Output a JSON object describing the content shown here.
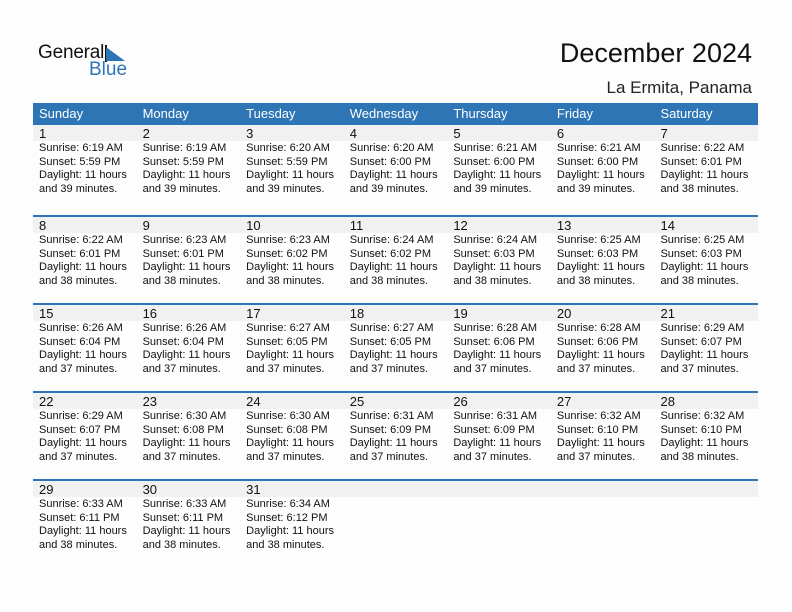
{
  "logo": {
    "general": "General",
    "blue": "Blue",
    "accent": "#2E75B6"
  },
  "header": {
    "title": "December 2024",
    "location": "La Ermita, Panama"
  },
  "weekdays": [
    "Sunday",
    "Monday",
    "Tuesday",
    "Wednesday",
    "Thursday",
    "Friday",
    "Saturday"
  ],
  "weeks": [
    [
      {
        "day": "1",
        "sunrise": "Sunrise: 6:19 AM",
        "sunset": "Sunset: 5:59 PM",
        "daylight": "Daylight: 11 hours",
        "minutes": "and 39 minutes."
      },
      {
        "day": "2",
        "sunrise": "Sunrise: 6:19 AM",
        "sunset": "Sunset: 5:59 PM",
        "daylight": "Daylight: 11 hours",
        "minutes": "and 39 minutes."
      },
      {
        "day": "3",
        "sunrise": "Sunrise: 6:20 AM",
        "sunset": "Sunset: 5:59 PM",
        "daylight": "Daylight: 11 hours",
        "minutes": "and 39 minutes."
      },
      {
        "day": "4",
        "sunrise": "Sunrise: 6:20 AM",
        "sunset": "Sunset: 6:00 PM",
        "daylight": "Daylight: 11 hours",
        "minutes": "and 39 minutes."
      },
      {
        "day": "5",
        "sunrise": "Sunrise: 6:21 AM",
        "sunset": "Sunset: 6:00 PM",
        "daylight": "Daylight: 11 hours",
        "minutes": "and 39 minutes."
      },
      {
        "day": "6",
        "sunrise": "Sunrise: 6:21 AM",
        "sunset": "Sunset: 6:00 PM",
        "daylight": "Daylight: 11 hours",
        "minutes": "and 39 minutes."
      },
      {
        "day": "7",
        "sunrise": "Sunrise: 6:22 AM",
        "sunset": "Sunset: 6:01 PM",
        "daylight": "Daylight: 11 hours",
        "minutes": "and 38 minutes."
      }
    ],
    [
      {
        "day": "8",
        "sunrise": "Sunrise: 6:22 AM",
        "sunset": "Sunset: 6:01 PM",
        "daylight": "Daylight: 11 hours",
        "minutes": "and 38 minutes."
      },
      {
        "day": "9",
        "sunrise": "Sunrise: 6:23 AM",
        "sunset": "Sunset: 6:01 PM",
        "daylight": "Daylight: 11 hours",
        "minutes": "and 38 minutes."
      },
      {
        "day": "10",
        "sunrise": "Sunrise: 6:23 AM",
        "sunset": "Sunset: 6:02 PM",
        "daylight": "Daylight: 11 hours",
        "minutes": "and 38 minutes."
      },
      {
        "day": "11",
        "sunrise": "Sunrise: 6:24 AM",
        "sunset": "Sunset: 6:02 PM",
        "daylight": "Daylight: 11 hours",
        "minutes": "and 38 minutes."
      },
      {
        "day": "12",
        "sunrise": "Sunrise: 6:24 AM",
        "sunset": "Sunset: 6:03 PM",
        "daylight": "Daylight: 11 hours",
        "minutes": "and 38 minutes."
      },
      {
        "day": "13",
        "sunrise": "Sunrise: 6:25 AM",
        "sunset": "Sunset: 6:03 PM",
        "daylight": "Daylight: 11 hours",
        "minutes": "and 38 minutes."
      },
      {
        "day": "14",
        "sunrise": "Sunrise: 6:25 AM",
        "sunset": "Sunset: 6:03 PM",
        "daylight": "Daylight: 11 hours",
        "minutes": "and 38 minutes."
      }
    ],
    [
      {
        "day": "15",
        "sunrise": "Sunrise: 6:26 AM",
        "sunset": "Sunset: 6:04 PM",
        "daylight": "Daylight: 11 hours",
        "minutes": "and 37 minutes."
      },
      {
        "day": "16",
        "sunrise": "Sunrise: 6:26 AM",
        "sunset": "Sunset: 6:04 PM",
        "daylight": "Daylight: 11 hours",
        "minutes": "and 37 minutes."
      },
      {
        "day": "17",
        "sunrise": "Sunrise: 6:27 AM",
        "sunset": "Sunset: 6:05 PM",
        "daylight": "Daylight: 11 hours",
        "minutes": "and 37 minutes."
      },
      {
        "day": "18",
        "sunrise": "Sunrise: 6:27 AM",
        "sunset": "Sunset: 6:05 PM",
        "daylight": "Daylight: 11 hours",
        "minutes": "and 37 minutes."
      },
      {
        "day": "19",
        "sunrise": "Sunrise: 6:28 AM",
        "sunset": "Sunset: 6:06 PM",
        "daylight": "Daylight: 11 hours",
        "minutes": "and 37 minutes."
      },
      {
        "day": "20",
        "sunrise": "Sunrise: 6:28 AM",
        "sunset": "Sunset: 6:06 PM",
        "daylight": "Daylight: 11 hours",
        "minutes": "and 37 minutes."
      },
      {
        "day": "21",
        "sunrise": "Sunrise: 6:29 AM",
        "sunset": "Sunset: 6:07 PM",
        "daylight": "Daylight: 11 hours",
        "minutes": "and 37 minutes."
      }
    ],
    [
      {
        "day": "22",
        "sunrise": "Sunrise: 6:29 AM",
        "sunset": "Sunset: 6:07 PM",
        "daylight": "Daylight: 11 hours",
        "minutes": "and 37 minutes."
      },
      {
        "day": "23",
        "sunrise": "Sunrise: 6:30 AM",
        "sunset": "Sunset: 6:08 PM",
        "daylight": "Daylight: 11 hours",
        "minutes": "and 37 minutes."
      },
      {
        "day": "24",
        "sunrise": "Sunrise: 6:30 AM",
        "sunset": "Sunset: 6:08 PM",
        "daylight": "Daylight: 11 hours",
        "minutes": "and 37 minutes."
      },
      {
        "day": "25",
        "sunrise": "Sunrise: 6:31 AM",
        "sunset": "Sunset: 6:09 PM",
        "daylight": "Daylight: 11 hours",
        "minutes": "and 37 minutes."
      },
      {
        "day": "26",
        "sunrise": "Sunrise: 6:31 AM",
        "sunset": "Sunset: 6:09 PM",
        "daylight": "Daylight: 11 hours",
        "minutes": "and 37 minutes."
      },
      {
        "day": "27",
        "sunrise": "Sunrise: 6:32 AM",
        "sunset": "Sunset: 6:10 PM",
        "daylight": "Daylight: 11 hours",
        "minutes": "and 37 minutes."
      },
      {
        "day": "28",
        "sunrise": "Sunrise: 6:32 AM",
        "sunset": "Sunset: 6:10 PM",
        "daylight": "Daylight: 11 hours",
        "minutes": "and 38 minutes."
      }
    ],
    [
      {
        "day": "29",
        "sunrise": "Sunrise: 6:33 AM",
        "sunset": "Sunset: 6:11 PM",
        "daylight": "Daylight: 11 hours",
        "minutes": "and 38 minutes."
      },
      {
        "day": "30",
        "sunrise": "Sunrise: 6:33 AM",
        "sunset": "Sunset: 6:11 PM",
        "daylight": "Daylight: 11 hours",
        "minutes": "and 38 minutes."
      },
      {
        "day": "31",
        "sunrise": "Sunrise: 6:34 AM",
        "sunset": "Sunset: 6:12 PM",
        "daylight": "Daylight: 11 hours",
        "minutes": "and 38 minutes."
      },
      {
        "day": "",
        "sunrise": "",
        "sunset": "",
        "daylight": "",
        "minutes": ""
      },
      {
        "day": "",
        "sunrise": "",
        "sunset": "",
        "daylight": "",
        "minutes": ""
      },
      {
        "day": "",
        "sunrise": "",
        "sunset": "",
        "daylight": "",
        "minutes": ""
      },
      {
        "day": "",
        "sunrise": "",
        "sunset": "",
        "daylight": "",
        "minutes": ""
      }
    ]
  ]
}
